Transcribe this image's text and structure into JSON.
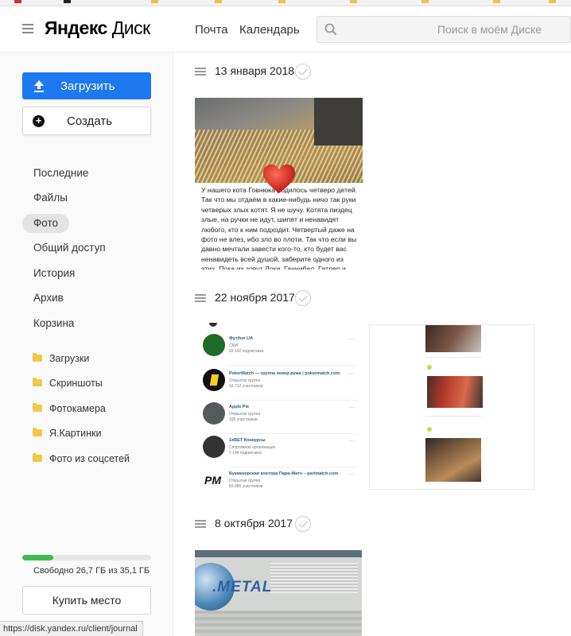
{
  "header": {
    "logo_brand": "Яндекс",
    "logo_product": "Диск",
    "nav": [
      "Почта",
      "Календарь"
    ],
    "search_placeholder": "Поиск в моём Диске"
  },
  "sidebar": {
    "upload_label": "Загрузить",
    "create_label": "Создать",
    "nav": [
      "Последние",
      "Файлы",
      "Фото",
      "Общий доступ",
      "История",
      "Архив",
      "Корзина"
    ],
    "active_nav": "Фото",
    "folders": [
      "Загрузки",
      "Скриншоты",
      "Фотокамера",
      "Я.Картинки",
      "Фото из соцсетей"
    ],
    "storage_text": "Свободно 26,7 ГБ из 35,1 ГБ",
    "storage_used_fraction": 0.24,
    "buy_label": "Купить место"
  },
  "groups": [
    {
      "date": "13 января 2018"
    },
    {
      "date": "22 ноября 2017"
    },
    {
      "date": "8 октября 2017"
    }
  ],
  "photo1_text": "У нашего кота Говнюка родилось четверо детей. Так что мы отдаём в какие-нибудь ничо так руки четверых злых котят. Я не шучу. Котята пиздец злые, на ручки не идут, шипят и ненавидят любого, кто к ним подходит. Четвертый даже на фото не влез, ибо зло во плоти. Так что если вы давно мечтали завести кого-то, кто будет вас ненавидеть всей душой, заберите одного из этих. Пока их зовут Локи, Ганнибал, Гитлер и Апокалипсис, но вы можете",
  "vk_list": [
    {
      "title": "Футбол UA",
      "sub": "СМИ",
      "sub2": "92 142 подписчика",
      "color": "#1f6b2a"
    },
    {
      "title": "PokerMatch — группа покер-рума | pokermatch.com",
      "sub": "Открытая группа",
      "sub2": "16 712 участников",
      "color": "#111111"
    },
    {
      "title": "Apple Pie",
      "sub": "Открытая группа",
      "sub2": "335 участников",
      "color": "#555b5a"
    },
    {
      "title": "1xBET Конкурсы",
      "sub": "Спортивная организация",
      "sub2": "2 144 подписчика",
      "color": "#333333"
    },
    {
      "title": "Букмекерская контора Пари-Матч – parimatch.com",
      "sub": "Открытая группа",
      "sub2": "83 886 участников",
      "color": "#1a1a1a"
    }
  ],
  "status_bar_url": "https://disk.yandex.ru/client/journal",
  "colors": {
    "accent": "#1e78f0",
    "storage": "#3dbb52"
  }
}
